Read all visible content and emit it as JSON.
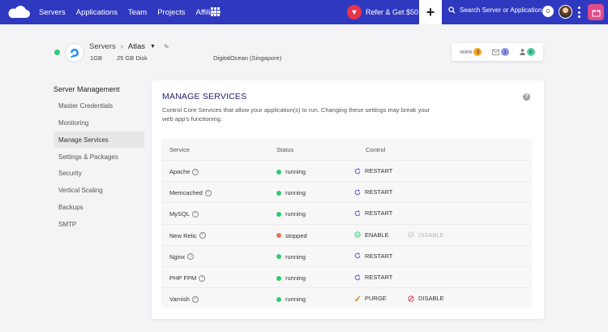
{
  "topbar": {
    "nav": [
      "Servers",
      "Applications",
      "Team",
      "Projects",
      "Affiliate"
    ],
    "refer_label": "Refer & Get $50",
    "search_placeholder": "Search Server or Application",
    "notification_count": "0",
    "colors": {
      "bar": "#2f39bf",
      "heart": "#e8334a",
      "gift": "#e24b8a"
    }
  },
  "server": {
    "breadcrumb_root": "Servers",
    "name": "Atlas",
    "size": "1GB",
    "disk": "25 GB Disk",
    "provider": "DigitalOcean (Singapore)",
    "status_color": "#2ecc71",
    "counters": {
      "www": {
        "label": "www",
        "count": "3",
        "color": "#f5a623"
      },
      "mail": {
        "count": "1",
        "color": "#8e95e8"
      },
      "users": {
        "count": "0",
        "color": "#4fd1a5"
      }
    }
  },
  "sidebar": {
    "title": "Server Management",
    "items": [
      {
        "label": "Master Credentials",
        "active": false
      },
      {
        "label": "Monitoring",
        "active": false
      },
      {
        "label": "Manage Services",
        "active": true
      },
      {
        "label": "Settings & Packages",
        "active": false
      },
      {
        "label": "Security",
        "active": false
      },
      {
        "label": "Vertical Scaling",
        "active": false
      },
      {
        "label": "Backups",
        "active": false
      },
      {
        "label": "SMTP",
        "active": false
      }
    ]
  },
  "main": {
    "title": "MANAGE SERVICES",
    "description": "Control Core Services that allow your application(s) to run. Changing these settings may break your web app's functioning.",
    "columns": [
      "Service",
      "Status",
      "Control"
    ],
    "rows": [
      {
        "service": "Apache",
        "status": "running",
        "status_color": "#2ecc71",
        "actions": [
          {
            "label": "RESTART",
            "icon": "restart-icon",
            "enabled": true
          }
        ]
      },
      {
        "service": "Memcached",
        "status": "running",
        "status_color": "#2ecc71",
        "actions": [
          {
            "label": "RESTART",
            "icon": "restart-icon",
            "enabled": true
          }
        ]
      },
      {
        "service": "MySQL",
        "status": "running",
        "status_color": "#2ecc71",
        "actions": [
          {
            "label": "RESTART",
            "icon": "restart-icon",
            "enabled": true
          }
        ]
      },
      {
        "service": "New Relic",
        "status": "stopped",
        "status_color": "#e8735a",
        "actions": [
          {
            "label": "ENABLE",
            "icon": "enable-icon",
            "enabled": true
          },
          {
            "label": "DISABLE",
            "icon": "disable-icon",
            "enabled": false
          }
        ]
      },
      {
        "service": "Nginx",
        "status": "running",
        "status_color": "#2ecc71",
        "actions": [
          {
            "label": "RESTART",
            "icon": "restart-icon",
            "enabled": true
          }
        ]
      },
      {
        "service": "PHP FPM",
        "status": "running",
        "status_color": "#2ecc71",
        "actions": [
          {
            "label": "RESTART",
            "icon": "restart-icon",
            "enabled": true
          }
        ]
      },
      {
        "service": "Varnish",
        "status": "running",
        "status_color": "#2ecc71",
        "actions": [
          {
            "label": "PURGE",
            "icon": "broom-icon",
            "enabled": true
          },
          {
            "label": "DISABLE",
            "icon": "disable-icon",
            "enabled": true
          }
        ]
      }
    ]
  }
}
